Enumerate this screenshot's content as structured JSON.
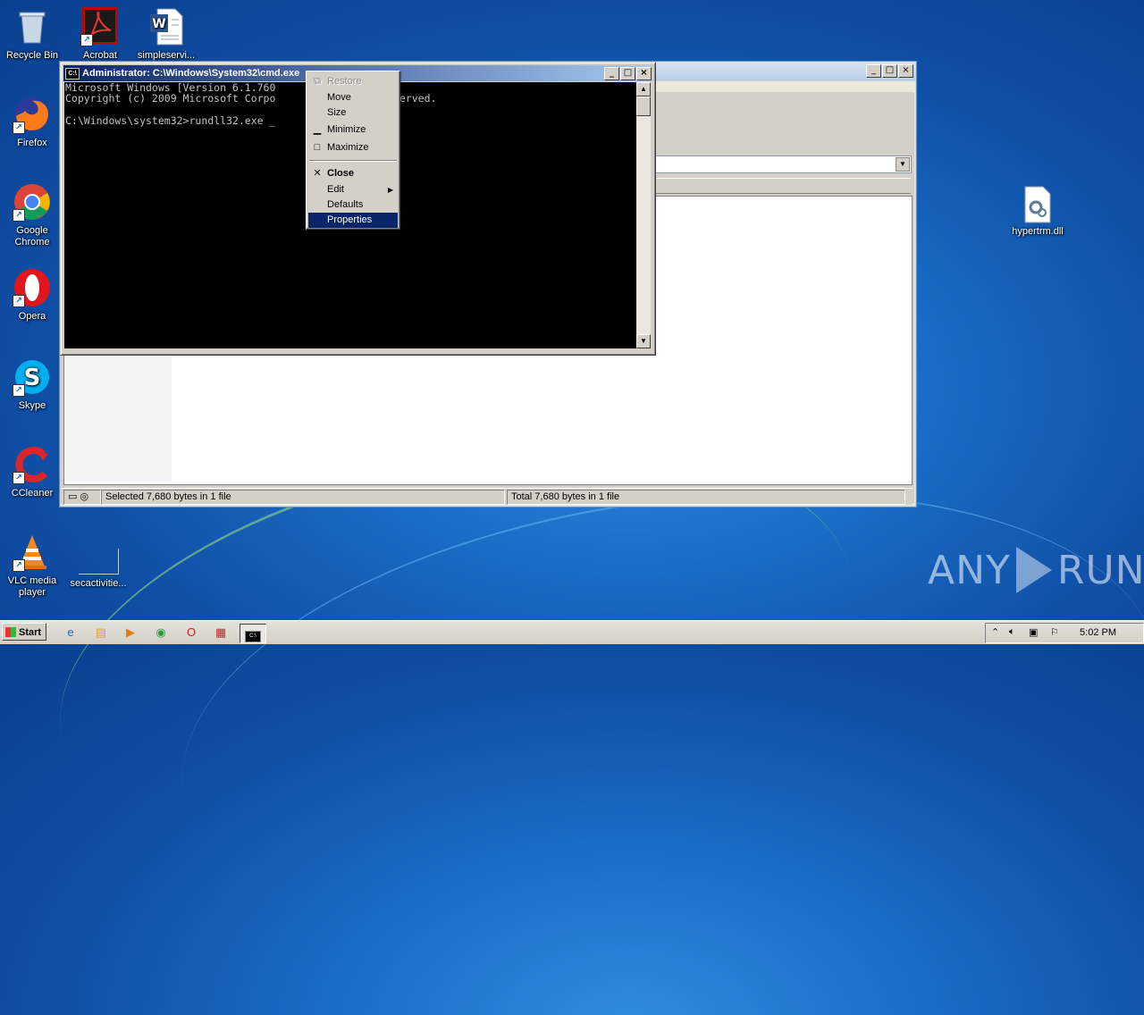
{
  "desktop": {
    "icons_left": [
      {
        "name": "recycle-bin",
        "label": "Recycle Bin"
      },
      {
        "name": "firefox",
        "label": "Firefox"
      },
      {
        "name": "google-chrome",
        "label": "Google Chrome"
      },
      {
        "name": "opera",
        "label": "Opera"
      },
      {
        "name": "skype",
        "label": "Skype"
      },
      {
        "name": "ccleaner",
        "label": "CCleaner"
      },
      {
        "name": "vlc",
        "label": "VLC media player"
      }
    ],
    "icons_top": [
      {
        "name": "acrobat",
        "label": "Acrobat"
      },
      {
        "name": "word-doc",
        "label": "simpleservi..."
      }
    ],
    "secactivities_label": "secactivitie...",
    "right_file": {
      "label": "hypertrm.dll"
    },
    "watermark": {
      "left": "ANY",
      "right": "RUN"
    }
  },
  "cmd_window": {
    "title": "Administrator: C:\\Windows\\System32\\cmd.exe",
    "console_lines": [
      "Microsoft Windows [Version 6.1.760",
      "Copyright (c) 2009 Microsoft Corpo          rights reserved.",
      "",
      "C:\\Windows\\system32>rundll32.exe _"
    ]
  },
  "context_menu": {
    "items": [
      {
        "label": "Restore",
        "state": "disabled",
        "glyph": "restore-icon"
      },
      {
        "label": "Move",
        "state": "normal"
      },
      {
        "label": "Size",
        "state": "normal"
      },
      {
        "label": "Minimize",
        "state": "normal",
        "glyph": "minimize-icon"
      },
      {
        "label": "Maximize",
        "state": "normal",
        "glyph": "maximize-icon"
      },
      {
        "label": "Close",
        "state": "bold",
        "glyph": "close-icon"
      },
      {
        "label": "Edit",
        "state": "submenu"
      },
      {
        "label": "Defaults",
        "state": "normal"
      },
      {
        "label": "Properties",
        "state": "selected"
      }
    ]
  },
  "explorer": {
    "status_left": "Selected 7,680 bytes in 1 file",
    "status_right": "Total 7,680 bytes in 1 file"
  },
  "taskbar": {
    "start_label": "Start",
    "clock": "5:02 PM"
  },
  "colors": {
    "title_active": "#0a246a",
    "menu_highlight": "#0a246a",
    "desktop": "#1a6bc4"
  }
}
